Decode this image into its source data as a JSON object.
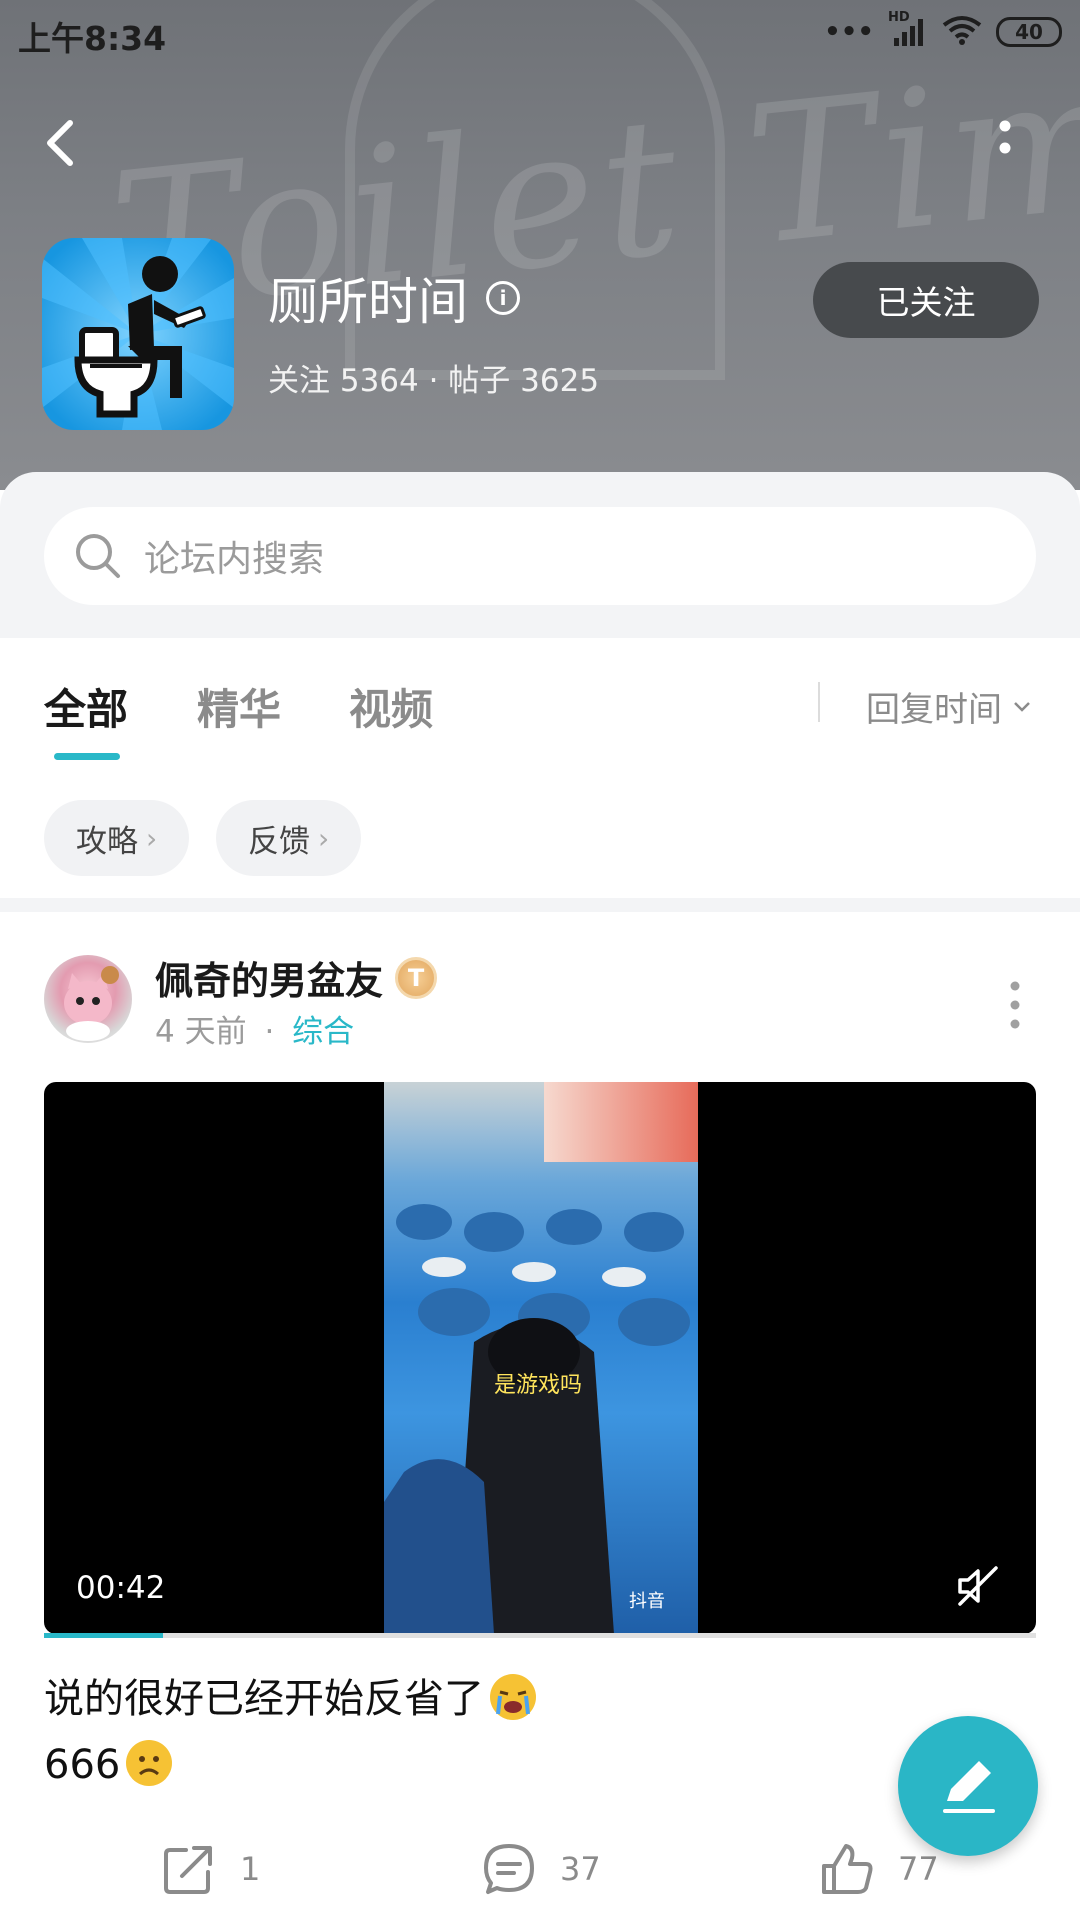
{
  "status_bar": {
    "time": "上午8:34",
    "network": "HD",
    "battery": "40"
  },
  "header": {
    "watermark_text": "Toilet Time!",
    "forum_title": "厕所时间",
    "stats": "关注 5364 · 帖子 3625",
    "follow_button": "已关注"
  },
  "search": {
    "placeholder": "论坛内搜索"
  },
  "tabs": [
    {
      "label": "全部",
      "active": true
    },
    {
      "label": "精华",
      "active": false
    },
    {
      "label": "视频",
      "active": false
    }
  ],
  "sort": {
    "label": "回复时间"
  },
  "chips": [
    {
      "label": "攻略"
    },
    {
      "label": "反馈"
    }
  ],
  "post": {
    "author": "佩奇的男盆友",
    "badge": "T",
    "time_ago": "4 天前",
    "separator": "·",
    "category": "综合",
    "video": {
      "duration": "00:42",
      "caption": "是游戏吗",
      "watermark": "抖音",
      "progress": 0.12
    },
    "text_line1": "说的很好已经开始反省了",
    "text_line2": "666",
    "share_count": "1",
    "comment_count": "37",
    "like_count": "77"
  },
  "colors": {
    "accent": "#29b8c8",
    "follow_bg": "#474a4d",
    "header_bg": "#7a7d82",
    "icon_blue": "#1fa3e8"
  }
}
